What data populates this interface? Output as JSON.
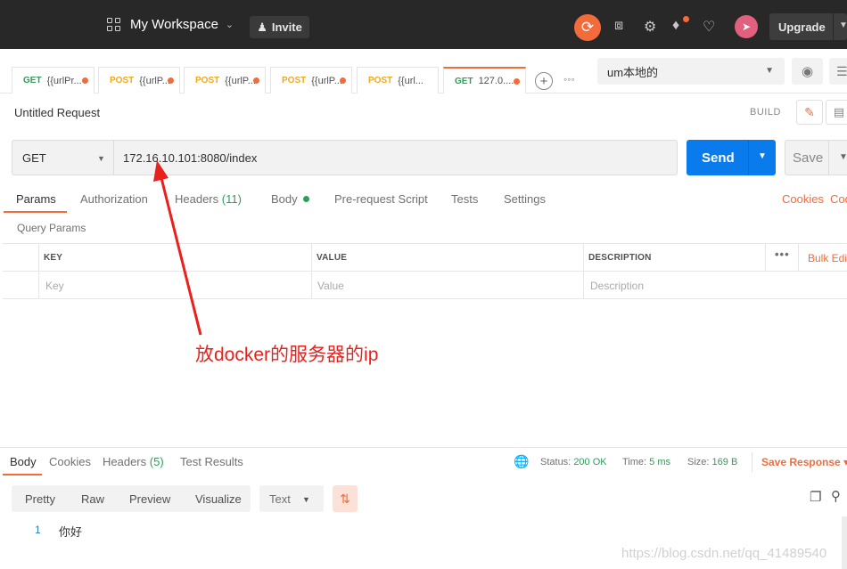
{
  "topbar": {
    "workspace_label": "My Workspace",
    "invite_label": "Invite",
    "upgrade_label": "Upgrade",
    "accent": "#f26b3a"
  },
  "tabs": [
    {
      "method": "GET",
      "name": "{{urlPr..."
    },
    {
      "method": "POST",
      "name": "{{urlP..."
    },
    {
      "method": "POST",
      "name": "{{urlP..."
    },
    {
      "method": "POST",
      "name": "{{urlP..."
    },
    {
      "method": "POST",
      "name": "{{url..."
    },
    {
      "method": "GET",
      "name": "127.0...."
    }
  ],
  "environment": {
    "selected": "um本地的"
  },
  "request": {
    "title": "Untitled Request",
    "build_label": "BUILD",
    "method": "GET",
    "url": "172.16.10.101:8080/index",
    "send_label": "Send",
    "save_label": "Save"
  },
  "request_tabs": {
    "params": "Params",
    "authorization": "Authorization",
    "headers": "Headers",
    "headers_count": "(11)",
    "body": "Body",
    "prerequest": "Pre-request Script",
    "tests": "Tests",
    "settings": "Settings",
    "cookies": "Cookies",
    "code": "Code"
  },
  "params": {
    "section_title": "Query Params",
    "columns": [
      "KEY",
      "VALUE",
      "DESCRIPTION"
    ],
    "placeholders": [
      "Key",
      "Value",
      "Description"
    ],
    "bulk_edit": "Bulk Edit"
  },
  "annotation": {
    "text": "放docker的服务器的ip",
    "color": "#e8211d"
  },
  "response": {
    "tabs": {
      "body": "Body",
      "cookies": "Cookies",
      "headers": "Headers",
      "headers_count": "(5)",
      "test_results": "Test Results"
    },
    "status_label": "Status:",
    "status_value": "200 OK",
    "time_label": "Time:",
    "time_value": "5 ms",
    "size_label": "Size:",
    "size_value": "169 B",
    "save_response": "Save Response",
    "formats": [
      "Pretty",
      "Raw",
      "Preview",
      "Visualize"
    ],
    "language": "Text",
    "line_number": "1",
    "body_text": "你好"
  },
  "watermark": "https://blog.csdn.net/qq_41489540"
}
